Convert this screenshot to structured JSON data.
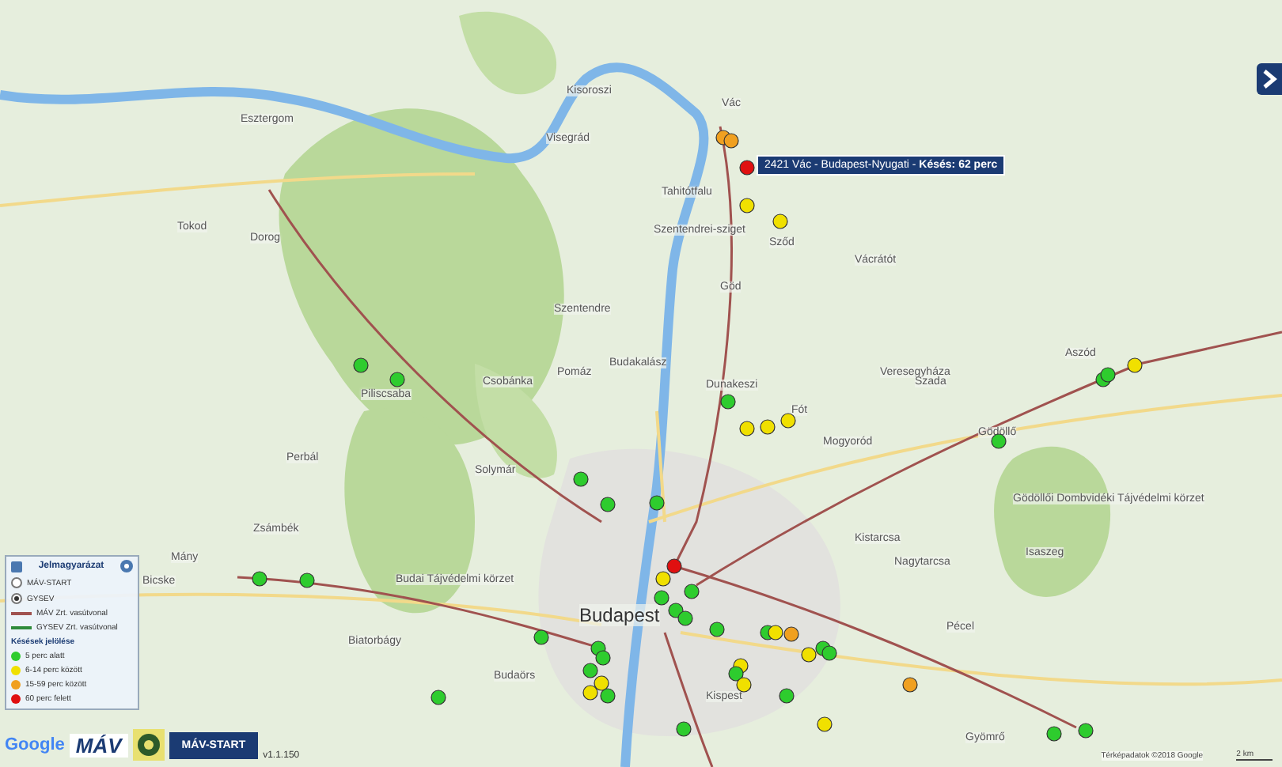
{
  "places": [
    {
      "name": "Esztergom"
    },
    {
      "name": "Tokod"
    },
    {
      "name": "Dorog"
    },
    {
      "name": "Kisoroszi"
    },
    {
      "name": "Visegrád"
    },
    {
      "name": "Vác"
    },
    {
      "name": "Tahitótfalu"
    },
    {
      "name": "Szentendrei-sziget"
    },
    {
      "name": "Sződ"
    },
    {
      "name": "Vácrátót"
    },
    {
      "name": "Göd"
    },
    {
      "name": "Szentendre"
    },
    {
      "name": "Pomáz"
    },
    {
      "name": "Csobánka"
    },
    {
      "name": "Budakalász"
    },
    {
      "name": "Piliscsaba"
    },
    {
      "name": "Dunakeszi"
    },
    {
      "name": "Fót"
    },
    {
      "name": "Mogyoród"
    },
    {
      "name": "Veresegyháza"
    },
    {
      "name": "Szada"
    },
    {
      "name": "Aszód"
    },
    {
      "name": "Gödöllő"
    },
    {
      "name": "Solymár"
    },
    {
      "name": "Perbál"
    },
    {
      "name": "Zsámbék"
    },
    {
      "name": "Mány"
    },
    {
      "name": "Bicske"
    },
    {
      "name": "Budai Tájvédelmi körzet"
    },
    {
      "name": "Budapest"
    },
    {
      "name": "Kistarcsa"
    },
    {
      "name": "Nagytarcsa"
    },
    {
      "name": "Isaszeg"
    },
    {
      "name": "Gödöllői Dombvidéki Tájvédelmi körzet"
    },
    {
      "name": "Biatorbágy"
    },
    {
      "name": "Budaörs"
    },
    {
      "name": "Kispest"
    },
    {
      "name": "Pécel"
    },
    {
      "name": "Gyömrő"
    }
  ],
  "trains": [
    {
      "color": "#f0a020"
    },
    {
      "color": "#f0a020"
    },
    {
      "color": "#e01010"
    },
    {
      "color": "#f0e000"
    },
    {
      "color": "#f0e000"
    },
    {
      "color": "#2ecc2e"
    },
    {
      "color": "#f0e000"
    },
    {
      "color": "#f0e000"
    },
    {
      "color": "#f0e000"
    },
    {
      "color": "#2ecc2e"
    },
    {
      "color": "#2ecc2e"
    },
    {
      "color": "#f0e000"
    },
    {
      "color": "#2ecc2e"
    },
    {
      "color": "#e01010"
    },
    {
      "color": "#f0e000"
    },
    {
      "color": "#2ecc2e"
    },
    {
      "color": "#2ecc2e"
    },
    {
      "color": "#2ecc2e"
    },
    {
      "color": "#2ecc2e"
    },
    {
      "color": "#2ecc2e"
    },
    {
      "color": "#2ecc2e"
    },
    {
      "color": "#f0e000"
    },
    {
      "color": "#f0a020"
    },
    {
      "color": "#f0e000"
    },
    {
      "color": "#2ecc2e"
    },
    {
      "color": "#2ecc2e"
    },
    {
      "color": "#f0a020"
    },
    {
      "color": "#f0e000"
    },
    {
      "color": "#2ecc2e"
    },
    {
      "color": "#f0e000"
    },
    {
      "color": "#2ecc2e"
    },
    {
      "color": "#f0e000"
    },
    {
      "color": "#2ecc2e"
    },
    {
      "color": "#2ecc2e"
    },
    {
      "color": "#2ecc2e"
    },
    {
      "color": "#2ecc2e"
    },
    {
      "color": "#f0e000"
    },
    {
      "color": "#f0e000"
    },
    {
      "color": "#2ecc2e"
    },
    {
      "color": "#2ecc2e"
    },
    {
      "color": "#2ecc2e"
    },
    {
      "color": "#2ecc2e"
    },
    {
      "color": "#2ecc2e"
    },
    {
      "color": "#2ecc2e"
    },
    {
      "color": "#2ecc2e"
    },
    {
      "color": "#2ecc2e"
    },
    {
      "color": "#2ecc2e"
    },
    {
      "color": "#2ecc2e"
    },
    {
      "color": "#2ecc2e"
    },
    {
      "color": "#2ecc2e"
    }
  ],
  "tooltip": {
    "text": "2421 Vác - Budapest-Nyugati - **Késés: 62 perc**"
  },
  "legend": {
    "title": "Jelmagyarázat",
    "operators": [
      {
        "label": "MÁV-START",
        "selected": false
      },
      {
        "label": "GYSEV",
        "selected": true
      }
    ],
    "lines": [
      {
        "label": "MÁV Zrt. vasútvonal",
        "color": "#a0524f"
      },
      {
        "label": "GYSEV Zrt. vasútvonal",
        "color": "#2e8b3a"
      }
    ],
    "delay_title": "Késések jelölése",
    "delays": [
      {
        "label": "5 perc alatt",
        "color": "#2ecc2e"
      },
      {
        "label": "6-14 perc között",
        "color": "#f0e000"
      },
      {
        "label": "15-59 perc között",
        "color": "#f0a020"
      },
      {
        "label": "60 perc felett",
        "color": "#e01010"
      }
    ]
  },
  "footer": {
    "google": "Google",
    "mav": "MÁV",
    "mavstart": "MÁV-START",
    "version": "v1.1.150",
    "attribution": "Térképadatok ©2018 Google",
    "scale": "2 km"
  }
}
